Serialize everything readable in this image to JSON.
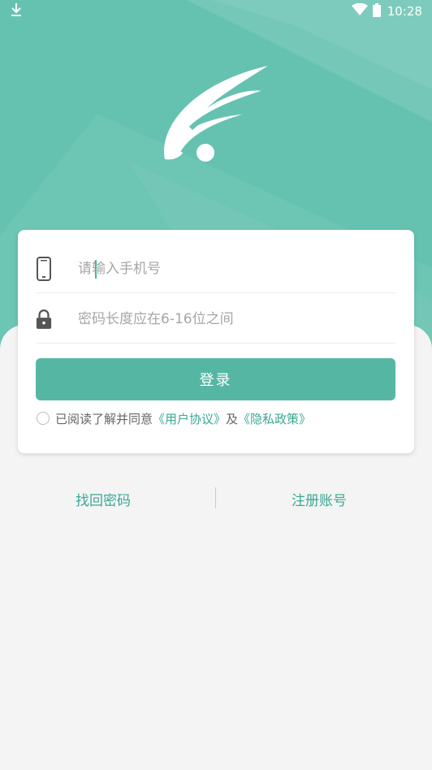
{
  "status_bar": {
    "time": "10:28",
    "icons": [
      "download-icon",
      "wifi-icon",
      "battery-icon"
    ]
  },
  "colors": {
    "hero": "#66c2b0",
    "accent": "#55b7a3",
    "link": "#3aa893",
    "background": "#f4f4f4"
  },
  "logo": {
    "icon": "wing-logo-icon"
  },
  "form": {
    "phone": {
      "icon": "phone-icon",
      "placeholder": "请输入手机号",
      "value": ""
    },
    "password": {
      "icon": "lock-icon",
      "placeholder": "密码长度应在6-16位之间",
      "value": ""
    },
    "login_label": "登录"
  },
  "agreement": {
    "checked": false,
    "text_prefix": "已阅读了解并同意",
    "user_agreement": "《用户协议》",
    "and": "及",
    "privacy_policy": "《隐私政策》"
  },
  "links": {
    "forgot_password": "找回密码",
    "register": "注册账号"
  }
}
